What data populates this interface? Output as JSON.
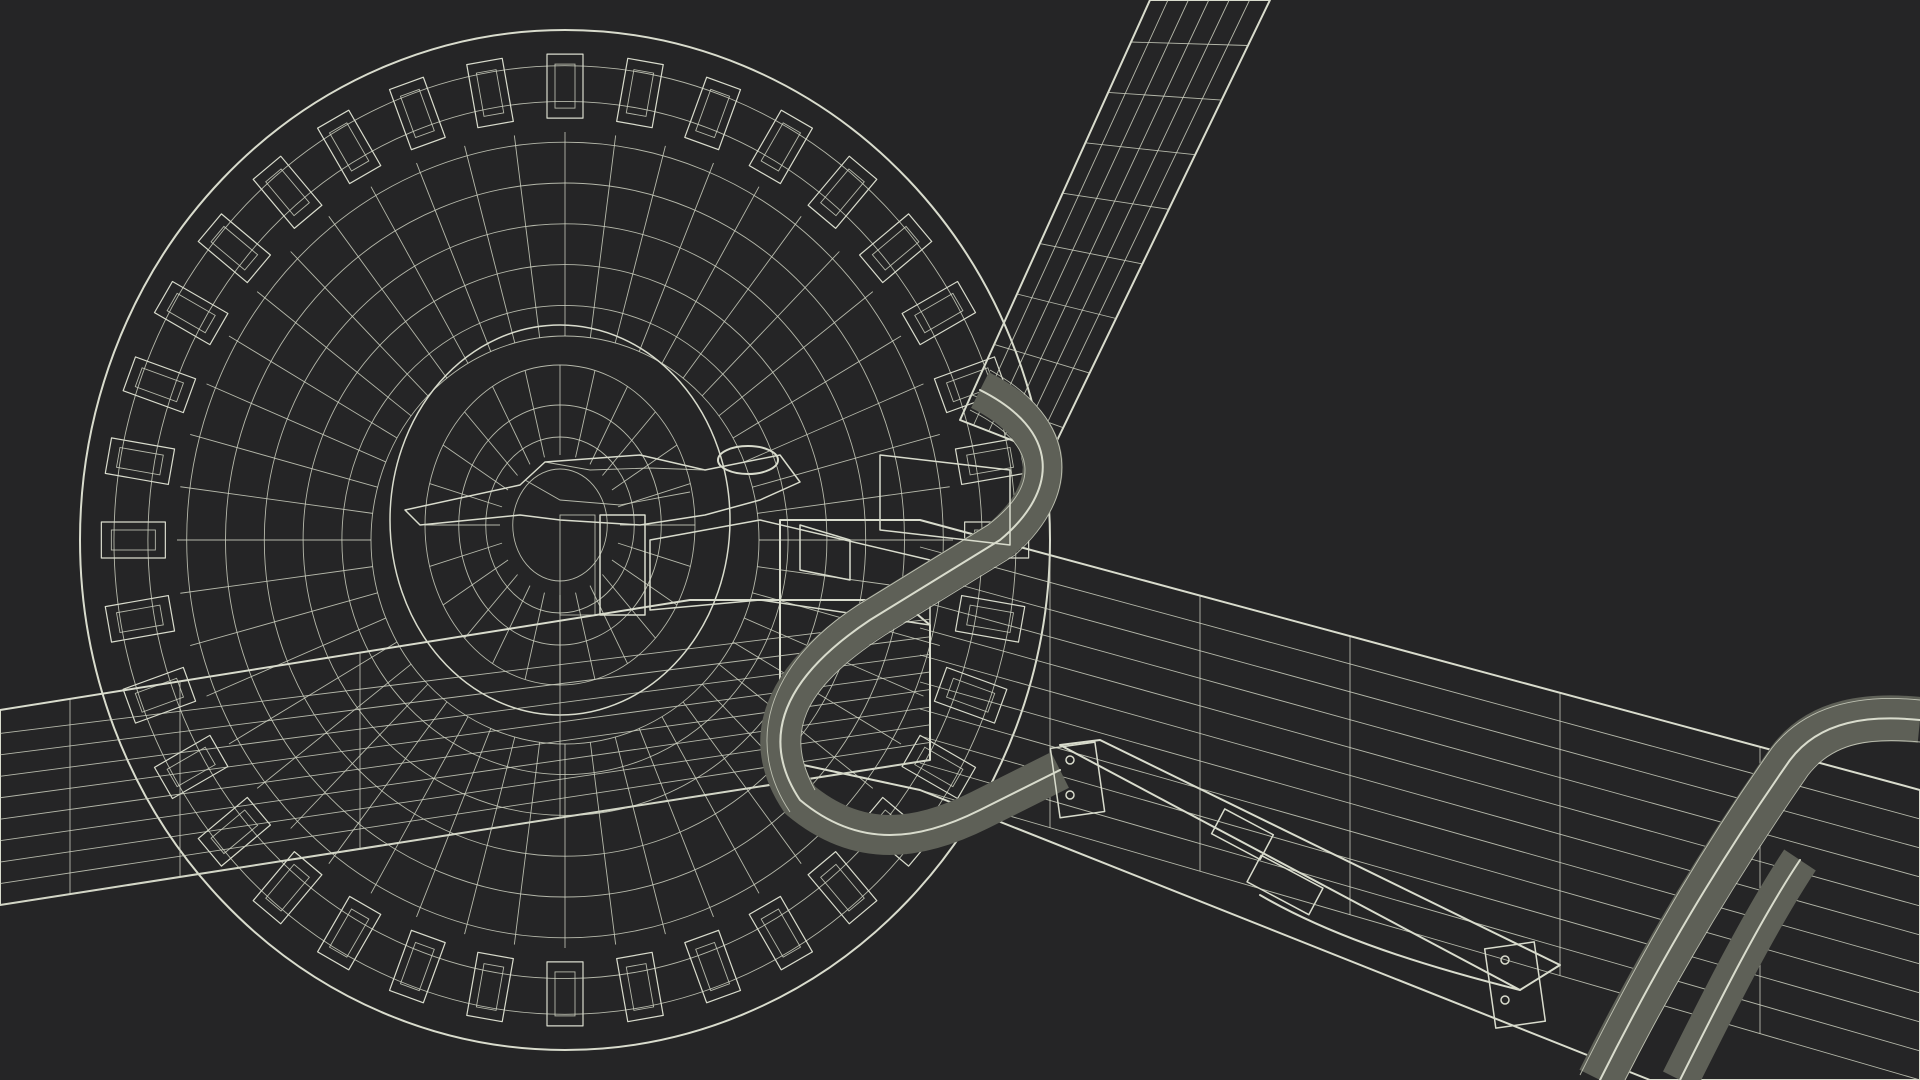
{
  "image": {
    "background_color": "#252526",
    "mesh_fill_color": "#66685d",
    "mesh_shadow_color": "#4e5048",
    "wire_color": "#d9dccd"
  },
  "objects": [
    {
      "name": "tire"
    },
    {
      "name": "wheel-hub"
    },
    {
      "name": "fifth-wheel-plate"
    },
    {
      "name": "upright-tow-bar"
    },
    {
      "name": "main-beam"
    },
    {
      "name": "cross-beam"
    },
    {
      "name": "tow-eye-loop"
    },
    {
      "name": "hydraulic-cylinder"
    },
    {
      "name": "handle-bar"
    }
  ]
}
